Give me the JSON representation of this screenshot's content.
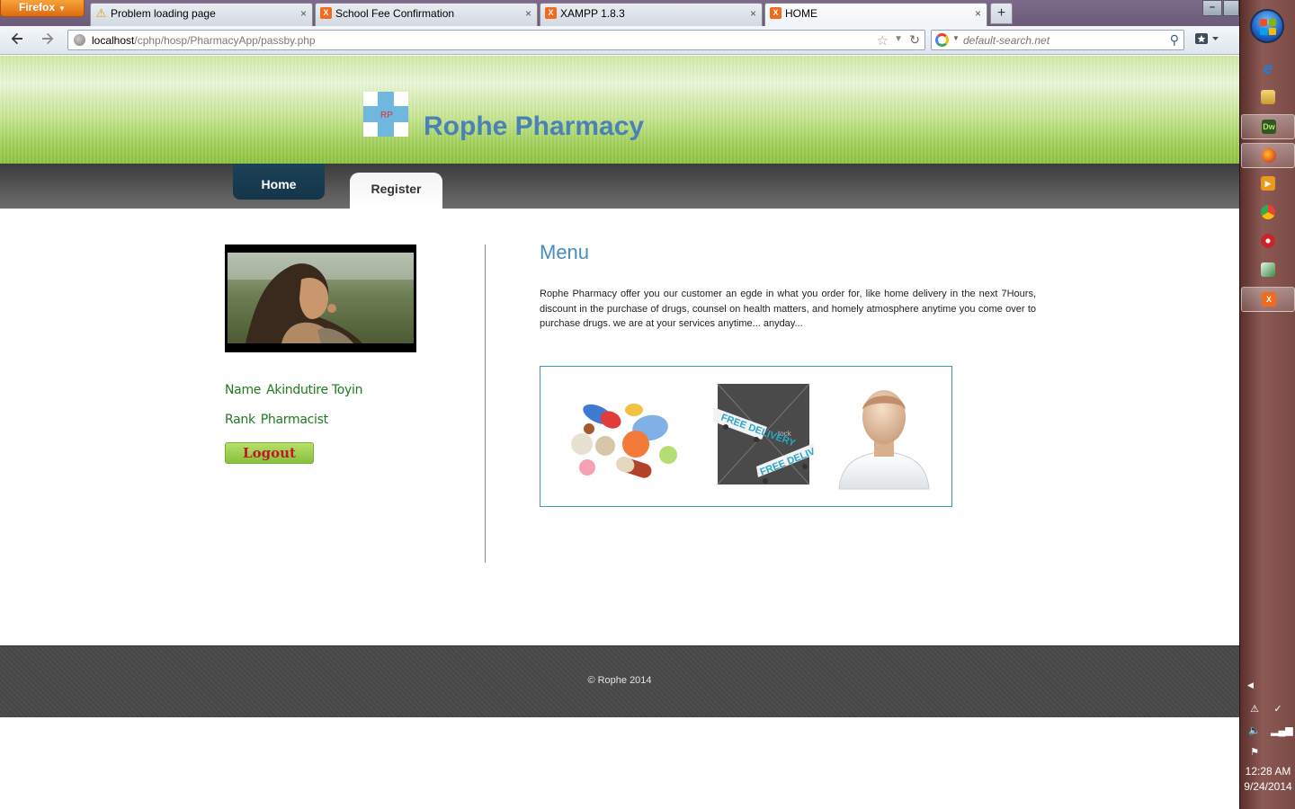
{
  "browser": {
    "menu_label": "Firefox",
    "tabs": [
      {
        "label": "Problem loading page",
        "icon": "warning-icon"
      },
      {
        "label": "School Fee Confirmation",
        "icon": "xampp-icon"
      },
      {
        "label": "XAMPP 1.8.3",
        "icon": "xampp-icon"
      },
      {
        "label": "HOME",
        "icon": "xampp-icon",
        "active": true
      }
    ],
    "new_tab": "+",
    "close_glyph": "×",
    "url_host": "localhost",
    "url_path": "/cphp/hosp/PharmacyApp/passby.php",
    "search_value": "default-search.net"
  },
  "site": {
    "title": "Rophe Pharmacy",
    "logo_letters": "RP",
    "nav": {
      "home": "Home",
      "register": "Register"
    },
    "profile": {
      "name_label": "Name",
      "name_value": "Akindutire Toyin",
      "rank_label": "Rank",
      "rank_value": "Pharmacist",
      "logout": "Logout"
    },
    "menu": {
      "heading": "Menu",
      "text": "Rophe Pharmacy offer you our customer an egde in what you order for, like home delivery in the next 7Hours, discount in the purchase of drugs, counsel on health matters, and homely atmosphere anytime you come over to purchase drugs. we are at your services anytime... anyday..."
    },
    "features": {
      "delivery_tag": "FREE DELIVERY",
      "delivery_watermark": "tock"
    },
    "footer": "© Rophe 2014"
  },
  "taskbar": {
    "pinned": [
      {
        "name": "ie-icon",
        "color": "#1f7fd6",
        "label": "e"
      },
      {
        "name": "explorer-icon",
        "color": "#d9b44a",
        "label": ""
      },
      {
        "name": "dreamweaver-icon",
        "color": "#2f5a1e",
        "label": "Dw"
      },
      {
        "name": "firefox-icon",
        "color": "#e66a1a",
        "label": ""
      },
      {
        "name": "media-player-icon",
        "color": "#e89a1e",
        "label": "▶"
      },
      {
        "name": "chrome-icon",
        "color": "#3c8d3c",
        "label": ""
      },
      {
        "name": "app-red-icon",
        "color": "#c8242c",
        "label": ""
      },
      {
        "name": "app-chart-icon",
        "color": "#3b8a45",
        "label": ""
      },
      {
        "name": "xampp-icon",
        "color": "#f26a1b",
        "label": "X"
      }
    ],
    "time": "12:28 AM",
    "date": "9/24/2014"
  },
  "colors": {
    "brand": "#4a82b7",
    "header_green": "#9ccd52",
    "nav_dark": "#1b4258",
    "profile_text": "#1f7a1f",
    "logout_text": "#c0182b"
  }
}
